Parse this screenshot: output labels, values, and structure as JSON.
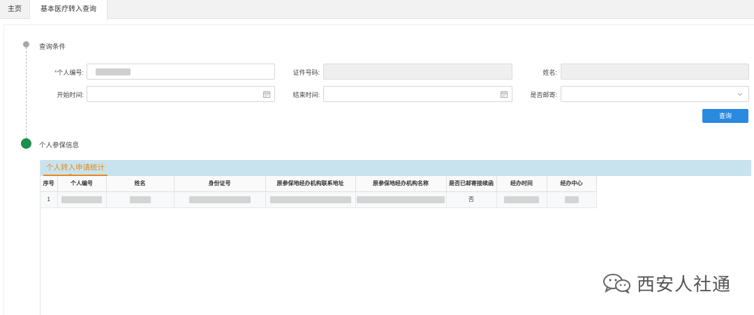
{
  "tabs": {
    "home": "主页",
    "active": "基本医疗转入查询"
  },
  "sections": {
    "query": "查询条件",
    "info": "个人参保信息"
  },
  "form": {
    "person_id": {
      "required_mark": "*",
      "label": "个人编号:"
    },
    "cert_no": {
      "label": "证件号码:"
    },
    "name": {
      "label": "姓名:"
    },
    "start_time": {
      "label": "开始时间:"
    },
    "end_time": {
      "label": "结束时间:"
    },
    "mailed": {
      "label": "是否邮寄:",
      "value": ""
    },
    "query_button": "查询"
  },
  "panel": {
    "tab_label": "个人转入申请统计",
    "columns": [
      "序号",
      "个人编号",
      "姓名",
      "身份证号",
      "原参保地经办机构联系地址",
      "原参保地经办机构名称",
      "是否已邮寄接续函",
      "经办时间",
      "经办中心"
    ],
    "rows": [
      {
        "index": "1",
        "mailed": "否"
      }
    ]
  },
  "watermark": {
    "text": "西安人社通",
    "icon": "wechat-icon"
  }
}
